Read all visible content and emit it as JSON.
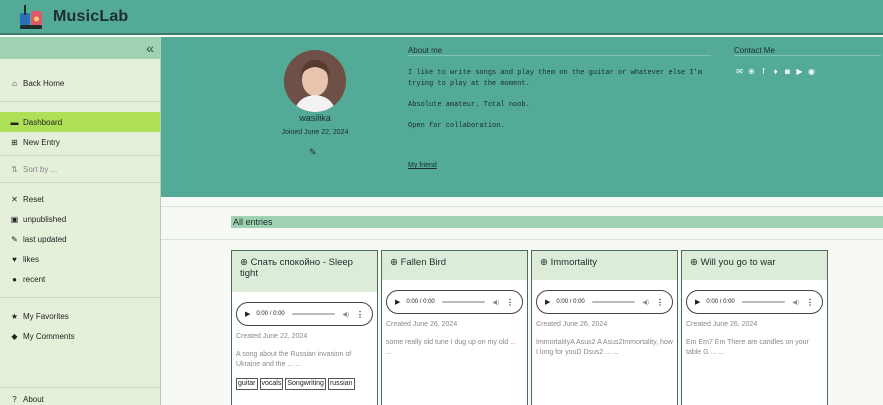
{
  "app": {
    "name": "MusicLab"
  },
  "sidebar": {
    "collapse_icon": "double-chevron-left",
    "back_home": "Back Home",
    "dashboard": "Dashboard",
    "new_entry": "New Entry",
    "sort_by": "Sort by ...",
    "filters": [
      {
        "icon": "x-icon",
        "label": "Reset"
      },
      {
        "icon": "lock-icon",
        "label": "unpublished"
      },
      {
        "icon": "pencil-icon",
        "label": "last updated"
      },
      {
        "icon": "heart-icon",
        "label": "likes"
      },
      {
        "icon": "clock-icon",
        "label": "recent"
      }
    ],
    "favorites": "My Favorites",
    "comments": "My Comments",
    "about": "About"
  },
  "profile": {
    "username": "wasilika",
    "joined": "Joined June 22, 2024",
    "about_title": "About me",
    "about_lines": [
      "I like to write songs and play them on the guitar or whatever else I'm trying to play at the moment.",
      "Absolute amateur. Total noob.",
      "Open for collaboration."
    ],
    "friend_link": "My friend",
    "contact_title": "Contact Me",
    "socials": [
      "email-icon",
      "globe-icon",
      "facebook-icon",
      "twitter-icon",
      "instagram-icon",
      "youtube-icon",
      "spotify-icon"
    ]
  },
  "entries": {
    "title": "All entries",
    "cards": [
      {
        "title": "Спать спокойно - Sleep tight",
        "time": "0:00 / 0:00",
        "created": "Created June 22, 2024",
        "desc": "A song about the Russian invasion of Ukraine and the ... ...",
        "tags": [
          "guitar",
          "vocals",
          "Songwriting",
          "russian"
        ]
      },
      {
        "title": "Fallen Bird",
        "time": "0:00 / 0:00",
        "created": "Created June 26, 2024",
        "desc": "some really old tune I dug up on my old ... ...",
        "tags": []
      },
      {
        "title": "Immortality",
        "time": "0:00 / 0:00",
        "created": "Created June 26, 2024",
        "desc": "ImmortalityA Asus2 A Asus2Immortality, how I long for youD Dsus2 ... ...",
        "tags": []
      },
      {
        "title": "Will you go to war",
        "time": "0:00 / 0:00",
        "created": "Created June 26, 2024",
        "desc": "Em Em7 Em There are candles on your table G ... ...",
        "tags": []
      }
    ]
  },
  "colors": {
    "header": "#53aa96",
    "sidebar": "#e5f0db",
    "active": "#aee057",
    "accent": "#9fd2b2"
  }
}
